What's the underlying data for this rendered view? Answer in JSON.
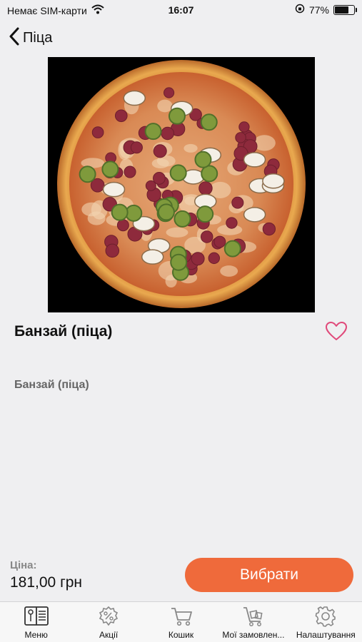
{
  "status_bar": {
    "carrier": "Немає SIM-карти",
    "time": "16:07",
    "battery_percent": "77%",
    "battery_level": 0.77
  },
  "nav": {
    "back_label": "Піца"
  },
  "product": {
    "title": "Банзай (піца)",
    "description": "Банзай (піца)",
    "favorite": false
  },
  "purchase": {
    "price_label": "Ціна:",
    "price_value": "181,00 грн",
    "button_label": "Вибрати"
  },
  "tabs": [
    {
      "label": "Меню",
      "icon": "menu-book-icon"
    },
    {
      "label": "Акції",
      "icon": "discount-icon"
    },
    {
      "label": "Кошик",
      "icon": "cart-icon"
    },
    {
      "label": "Мої замовлен...",
      "icon": "orders-cart-icon"
    },
    {
      "label": "Налаштування",
      "icon": "gear-icon"
    }
  ],
  "colors": {
    "accent": "#ef6a3b",
    "heart": "#e0497a",
    "background": "#efeff1"
  }
}
